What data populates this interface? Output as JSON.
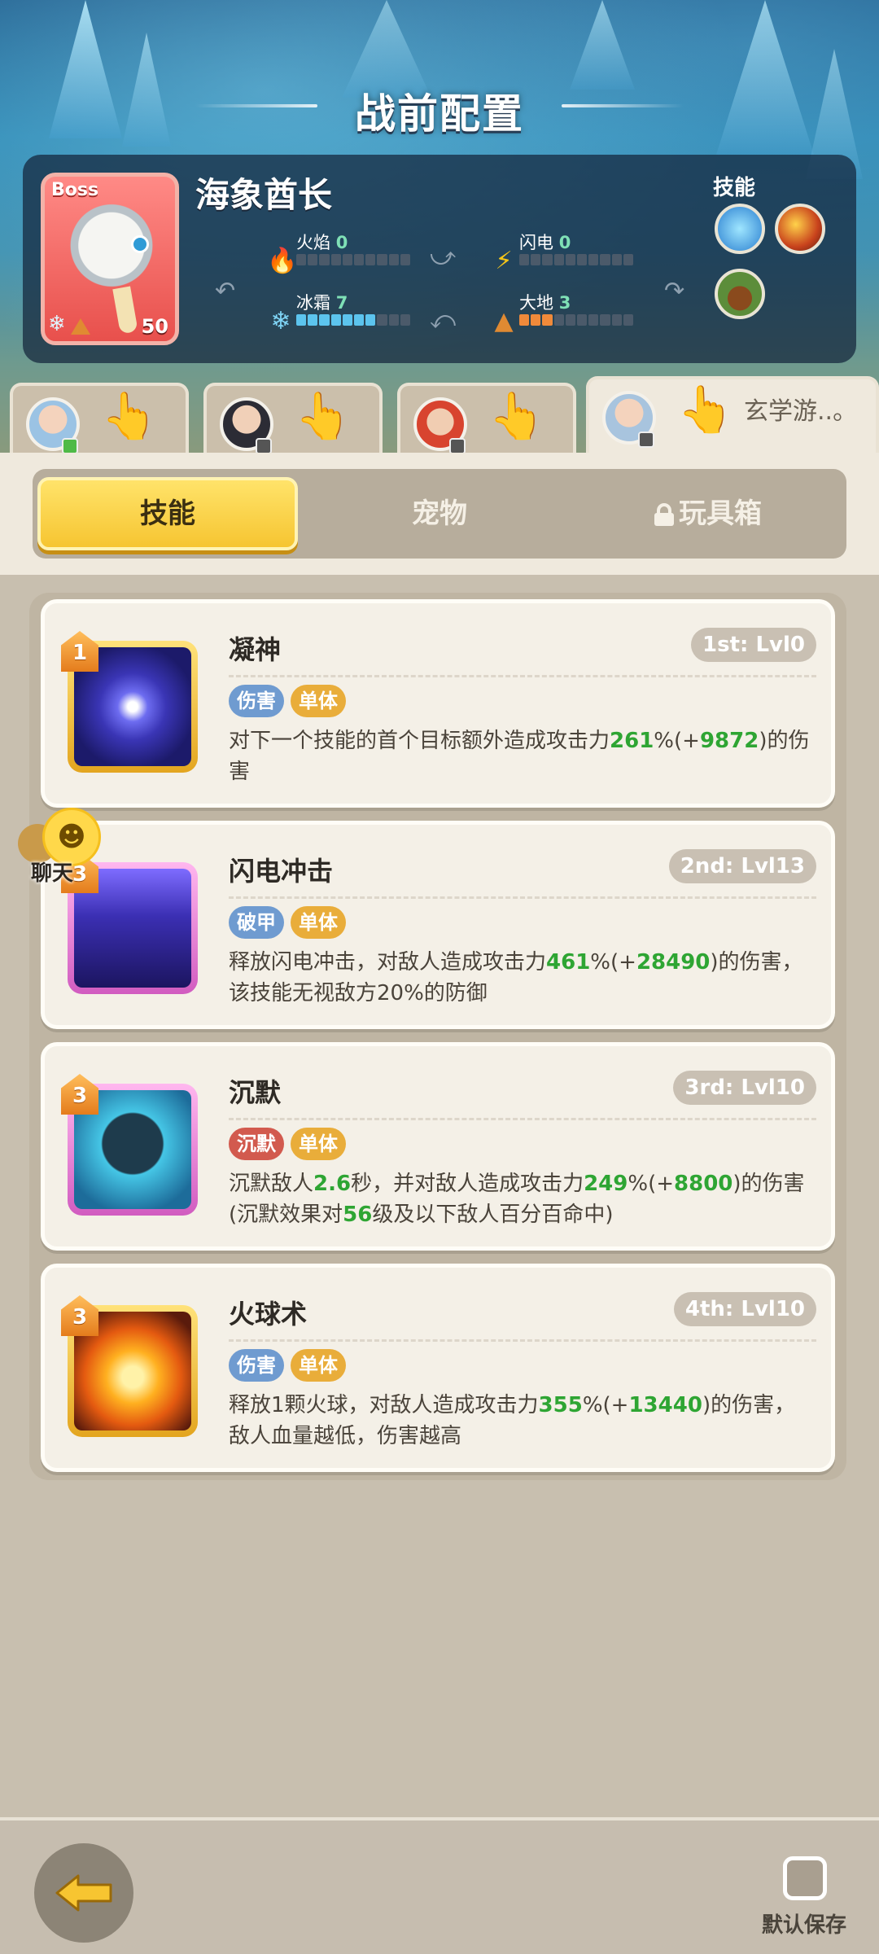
{
  "page_title": "战前配置",
  "boss": {
    "tag": "Boss",
    "name": "海象酋长",
    "level": "50",
    "stats": [
      {
        "label": "火焰",
        "value": "0",
        "filled": 0,
        "color": "#7fe0b6",
        "icon": "flame-icon"
      },
      {
        "label": "闪电",
        "value": "0",
        "filled": 0,
        "color": "#7fe0b6",
        "icon": "lightning-icon"
      },
      {
        "label": "冰霜",
        "value": "7",
        "filled": 7,
        "color": "#7fe0b6",
        "icon": "snowflake-icon"
      },
      {
        "label": "大地",
        "value": "3",
        "filled": 3,
        "color": "#7fe0b6",
        "icon": "earth-icon"
      }
    ],
    "skills_label": "技能"
  },
  "heroes": [
    {
      "name": "",
      "badge": "green"
    },
    {
      "name": "",
      "badge": "grey"
    },
    {
      "name": "",
      "badge": "grey"
    },
    {
      "name": "玄学游..。",
      "badge": "grey"
    }
  ],
  "tabs": {
    "skills": "技能",
    "pets": "宠物",
    "toybox": "玩具箱"
  },
  "skills": [
    {
      "rank": "1",
      "name": "凝神",
      "level": "1st: Lvl0",
      "tags": [
        {
          "text": "伤害",
          "kind": "blue"
        },
        {
          "text": "单体",
          "kind": "gold"
        }
      ],
      "desc_parts": [
        "对下一个技能的首个目标额外造成攻击力",
        "261",
        "%(+",
        "9872",
        ")的伤害"
      ]
    },
    {
      "rank": "3",
      "name": "闪电冲击",
      "level": "2nd: Lvl13",
      "tags": [
        {
          "text": "破甲",
          "kind": "blue"
        },
        {
          "text": "单体",
          "kind": "gold"
        }
      ],
      "desc_parts": [
        "释放闪电冲击，对敌人造成攻击力",
        "461",
        "%(+",
        "28490",
        ")的伤害，该技能无视敌方20%的防御"
      ]
    },
    {
      "rank": "3",
      "name": "沉默",
      "level": "3rd: Lvl10",
      "tags": [
        {
          "text": "沉默",
          "kind": "red"
        },
        {
          "text": "单体",
          "kind": "gold"
        }
      ],
      "desc_parts": [
        "沉默敌人",
        "2.6",
        "秒，并对敌人造成攻击力",
        "249",
        "%(+",
        "8800",
        ")的伤害(沉默效果对",
        "56",
        "级及以下敌人百分百命中)"
      ]
    },
    {
      "rank": "3",
      "name": "火球术",
      "level": "4th: Lvl10",
      "tags": [
        {
          "text": "伤害",
          "kind": "blue"
        },
        {
          "text": "单体",
          "kind": "gold"
        }
      ],
      "desc_parts": [
        "释放1颗火球，对敌人造成攻击力",
        "355",
        "%(+",
        "13440",
        ")的伤害，敌人血量越低，伤害越高"
      ]
    }
  ],
  "chat_label": "聊天",
  "save_label": "默认保存"
}
